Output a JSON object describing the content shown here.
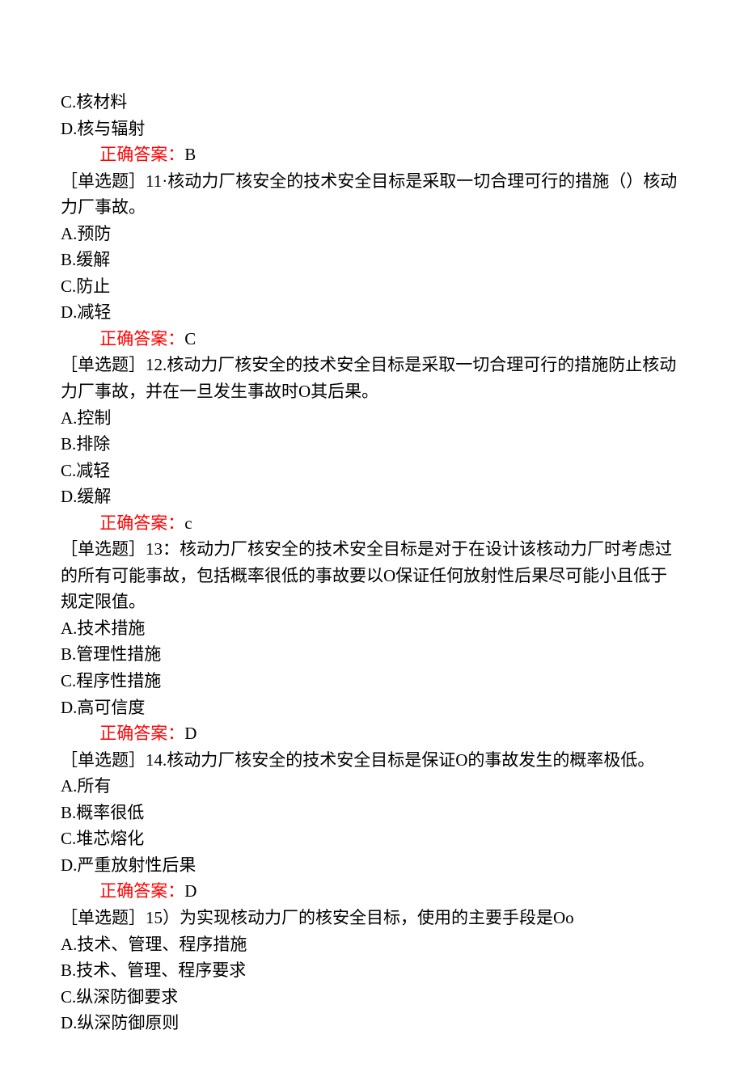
{
  "q10": {
    "optC": "C.核材料",
    "optD": "D.核与辐射",
    "answerLabel": "正确答案：",
    "answerLetter": "B"
  },
  "q11": {
    "stem": "［单选题］11·核动力厂核安全的技术安全目标是采取一切合理可行的措施（）核动力厂事故。",
    "optA": "A.预防",
    "optB": "B.缓解",
    "optC": "C.防止",
    "optD": "D.减轻",
    "answerLabel": "正确答案：",
    "answerLetter": "C"
  },
  "q12": {
    "stem": "［单选题］12.核动力厂核安全的技术安全目标是采取一切合理可行的措施防止核动力厂事故，并在一旦发生事故时O其后果。",
    "optA": "A.控制",
    "optB": "B.排除",
    "optC": "C.减轻",
    "optD": "D.缓解",
    "answerLabel": "正确答案：",
    "answerLetter": "c"
  },
  "q13": {
    "stem": "［单选题］13：核动力厂核安全的技术安全目标是对于在设计该核动力厂时考虑过的所有可能事故，包括概率很低的事故要以O保证任何放射性后果尽可能小且低于规定限值。",
    "optA": "A.技术措施",
    "optB": "B.管理性措施",
    "optC": "C.程序性措施",
    "optD": "D.高可信度",
    "answerLabel": "正确答案：",
    "answerLetter": "D"
  },
  "q14": {
    "stem": "［单选题］14.核动力厂核安全的技术安全目标是保证O的事故发生的概率极低。",
    "optA": "A.所有",
    "optB": "B.概率很低",
    "optC": "C.堆芯熔化",
    "optD": "D.严重放射性后果",
    "answerLabel": "正确答案：",
    "answerLetter": "D"
  },
  "q15": {
    "stem": "［单选题］15）为实现核动力厂的核安全目标，使用的主要手段是Oo",
    "optA": "A.技术、管理、程序措施",
    "optB": "B.技术、管理、程序要求",
    "optC": "C.纵深防御要求",
    "optD": "D.纵深防御原则"
  }
}
